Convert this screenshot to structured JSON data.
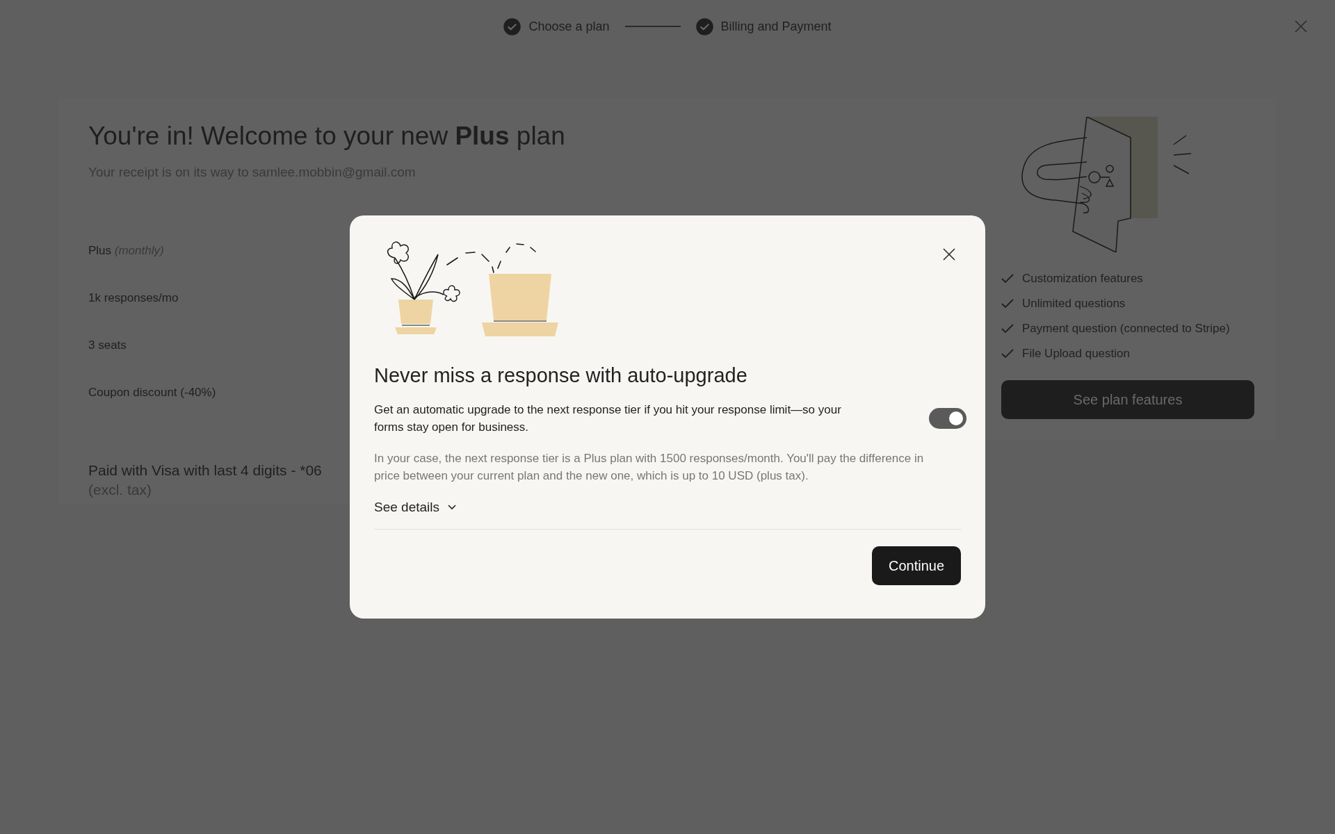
{
  "steps": [
    {
      "label": "Choose a plan",
      "done": true
    },
    {
      "label": "Billing and Payment",
      "done": true
    }
  ],
  "receipt": {
    "title": "You're in! Welcome to your new **Plus** plan",
    "subtitle": "Your receipt is on its way to samlee.mobbin@gmail.com",
    "line_items": [
      "Plus *(monthly)*",
      "1k responses/mo",
      "3 seats",
      "Coupon discount (-40%)"
    ],
    "payment": "Paid with Visa with last 4 digits - *06",
    "payment_note": "(excl. tax)"
  },
  "plan_card": {
    "features": [
      "Customization features",
      "Unlimited questions",
      "Payment question (connected to Stripe)",
      "File Upload question"
    ],
    "button": "See plan features"
  },
  "modal": {
    "title": "Never miss a response with auto-upgrade",
    "description": "Get an automatic upgrade to the next response tier if you hit your response limit—so your forms stay open for business.",
    "auto_upgrade_on": true,
    "detail": "In your case, the next response tier is a Plus plan with 1500 responses/month. You'll pay the difference in price between your current plan and the new one, which is up to 10 USD (plus tax).",
    "details_link": "See details",
    "button": "Continue"
  }
}
